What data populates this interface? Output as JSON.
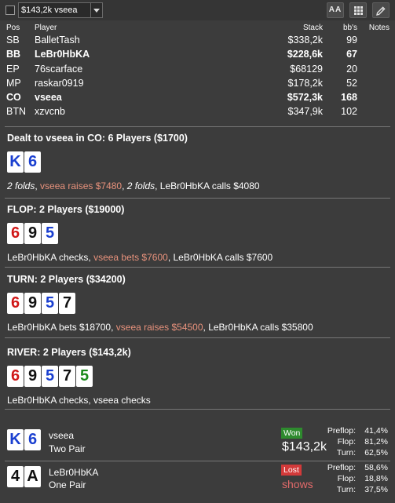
{
  "toolbar": {
    "filter_value": "$143,2k vseea",
    "font_button_label": "AA",
    "grid_icon": "grid-icon",
    "edit_icon": "pencil-icon"
  },
  "table": {
    "headers": {
      "pos": "Pos",
      "player": "Player",
      "stack": "Stack",
      "bbs": "bb's",
      "notes": "Notes"
    },
    "rows": [
      {
        "pos": "SB",
        "player": "BalletTash",
        "stack": "$338,2k",
        "bbs": "99",
        "bold": false
      },
      {
        "pos": "BB",
        "player": "LeBr0HbKA",
        "stack": "$228,6k",
        "bbs": "67",
        "bold": true
      },
      {
        "pos": "EP",
        "player": "76scarface",
        "stack": "$68129",
        "bbs": "20",
        "bold": false
      },
      {
        "pos": "MP",
        "player": "raskar0919",
        "stack": "$178,2k",
        "bbs": "52",
        "bold": false
      },
      {
        "pos": "CO",
        "player": "vseea",
        "stack": "$572,3k",
        "bbs": "168",
        "bold": true
      },
      {
        "pos": "BTN",
        "player": "xzvcnb",
        "stack": "$347,9k",
        "bbs": "102",
        "bold": false
      }
    ]
  },
  "preflop": {
    "title": "Dealt to vseea in CO: 6 Players ($1700)",
    "cards": [
      {
        "rank": "K",
        "suit": "blue"
      },
      {
        "rank": "6",
        "suit": "blue"
      }
    ],
    "actions": [
      {
        "text": "2 folds",
        "style": "italic"
      },
      {
        "text": ", ",
        "style": "plain"
      },
      {
        "text": "vseea raises $7480",
        "style": "hl"
      },
      {
        "text": ", ",
        "style": "plain"
      },
      {
        "text": "2 folds",
        "style": "italic"
      },
      {
        "text": ", LeBr0HbKA calls $4080",
        "style": "plain"
      }
    ]
  },
  "flop": {
    "title": "FLOP: 2 Players ($19000)",
    "cards": [
      {
        "rank": "6",
        "suit": "red"
      },
      {
        "rank": "9",
        "suit": "black"
      },
      {
        "rank": "5",
        "suit": "blue"
      }
    ],
    "actions": [
      {
        "text": "LeBr0HbKA checks, ",
        "style": "plain"
      },
      {
        "text": "vseea bets $7600",
        "style": "hl"
      },
      {
        "text": ", LeBr0HbKA calls $7600",
        "style": "plain"
      }
    ]
  },
  "turn": {
    "title": "TURN: 2 Players ($34200)",
    "cards": [
      {
        "rank": "6",
        "suit": "red"
      },
      {
        "rank": "9",
        "suit": "black"
      },
      {
        "rank": "5",
        "suit": "blue"
      },
      {
        "rank": "7",
        "suit": "black"
      }
    ],
    "actions": [
      {
        "text": "LeBr0HbKA bets $18700, ",
        "style": "plain"
      },
      {
        "text": "vseea raises $54500",
        "style": "hl"
      },
      {
        "text": ", LeBr0HbKA calls $35800",
        "style": "plain"
      }
    ]
  },
  "river": {
    "title": "RIVER: 2 Players ($143,2k)",
    "cards": [
      {
        "rank": "6",
        "suit": "red"
      },
      {
        "rank": "9",
        "suit": "black"
      },
      {
        "rank": "5",
        "suit": "blue"
      },
      {
        "rank": "7",
        "suit": "black"
      },
      {
        "rank": "5",
        "suit": "green"
      }
    ],
    "actions": [
      {
        "text": "LeBr0HbKA checks, vseea checks",
        "style": "plain"
      }
    ]
  },
  "results": [
    {
      "cards": [
        {
          "rank": "K",
          "suit": "blue"
        },
        {
          "rank": "6",
          "suit": "blue"
        }
      ],
      "name": "vseea",
      "hand": "Two Pair",
      "badge": "Won",
      "badge_type": "won",
      "amount": "$143,2k",
      "equity": [
        {
          "label": "Preflop:",
          "value": "41,4%"
        },
        {
          "label": "Flop:",
          "value": "81,2%"
        },
        {
          "label": "Turn:",
          "value": "62,5%"
        }
      ]
    },
    {
      "cards": [
        {
          "rank": "4",
          "suit": "black"
        },
        {
          "rank": "A",
          "suit": "black"
        }
      ],
      "name": "LeBr0HbKA",
      "hand": "One Pair",
      "badge": "Lost",
      "badge_type": "lost",
      "amount": "shows",
      "equity": [
        {
          "label": "Preflop:",
          "value": "58,6%"
        },
        {
          "label": "Flop:",
          "value": "18,8%"
        },
        {
          "label": "Turn:",
          "value": "37,5%"
        }
      ]
    }
  ],
  "colors": {
    "background": "#3c3c3c",
    "highlight": "#e8927c",
    "suit_blue": "#1a3fd0",
    "suit_red": "#d01818",
    "suit_green": "#1a8a1a",
    "suit_black": "#111111",
    "won": "#2e8b2e",
    "lost": "#d23a3a"
  }
}
